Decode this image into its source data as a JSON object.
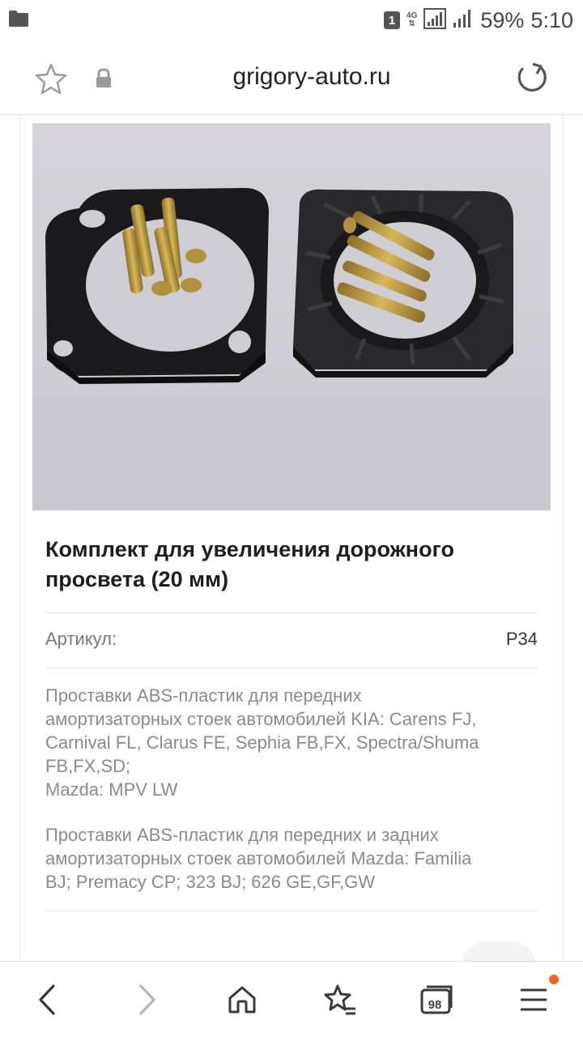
{
  "status_bar": {
    "sim_slot": "1",
    "network_type": "4G",
    "battery_percent": "59%",
    "time": "5:10"
  },
  "browser": {
    "url": "grigory-auto.ru",
    "open_tabs": "98"
  },
  "product": {
    "title": "Комплект для увеличения дорожного просвета (20 мм)",
    "sku_label": "Артикул:",
    "sku_value": "P34",
    "description_1": [
      "Проставки ABS-пластик для передних",
      "амортизаторных стоек автомобилей KIA: Carens FJ,",
      "Carnival FL, Clarus FE, Sephia FB,FX, Spectra/Shuma",
      "FB,FX,SD;",
      "Mazda: MPV LW"
    ],
    "description_2": [
      "Проставки ABS-пластик для передних и задних",
      "амортизаторных стоек автомобилей Mazda: Familia",
      "BJ; Premacy CP; 323 BJ; 626 GE,GF,GW"
    ]
  },
  "colors": {
    "accent": "#f06a1c",
    "text_primary": "#1e1e1e",
    "text_secondary": "#8a8a8a"
  },
  "icons": [
    "folder-icon",
    "signal-icon",
    "star-icon",
    "lock-icon",
    "reload-icon",
    "back-icon",
    "forward-icon",
    "home-icon",
    "bookmarks-icon",
    "tabs-icon",
    "menu-icon"
  ]
}
